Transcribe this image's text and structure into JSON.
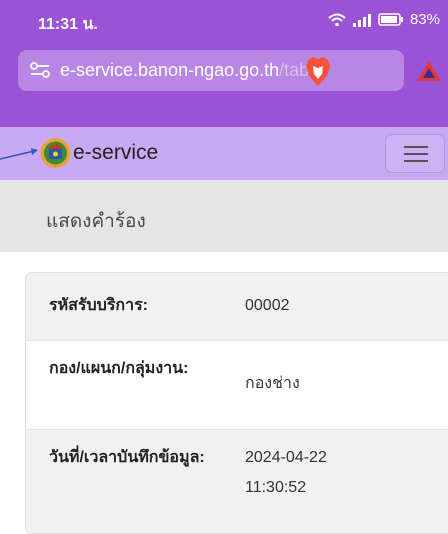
{
  "status_bar": {
    "time": "11:31 น.",
    "battery": "83%"
  },
  "address_bar": {
    "url_host": "e-service.banon-ngao.go.th",
    "url_path": "/tab"
  },
  "navbar": {
    "brand": "e-service"
  },
  "page": {
    "title": "แสดงคำร้อง"
  },
  "details": [
    {
      "label": "รหัสรับบริการ:",
      "value": "00002"
    },
    {
      "label": "กอง/แผนก/กลุ่มงาน:",
      "value": "กองช่าง"
    },
    {
      "label": "วันที่/เวลาบันทึกข้อมูล:",
      "value": "2024-04-22 11:30:52"
    }
  ],
  "colors": {
    "browser_bar": "#9a52d6",
    "navbar": "#c9a9f3",
    "heading_bar": "#e5e5e5"
  }
}
